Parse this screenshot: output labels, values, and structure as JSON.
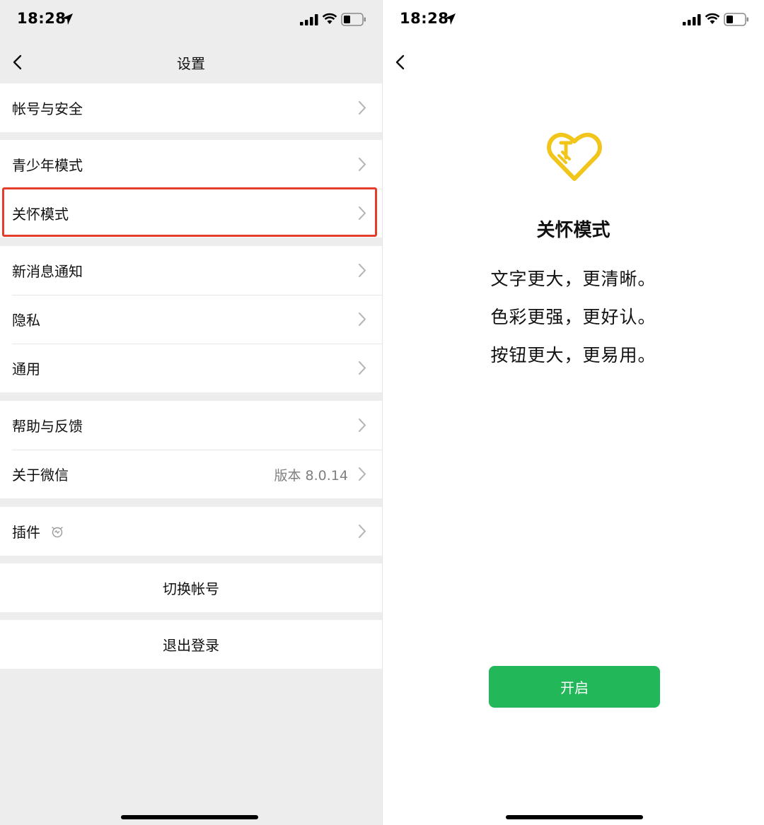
{
  "status_bar": {
    "time": "18:28"
  },
  "left": {
    "nav": {
      "title": "设置"
    },
    "groups": [
      {
        "items": [
          {
            "label": "帐号与安全"
          }
        ]
      },
      {
        "items": [
          {
            "label": "青少年模式"
          },
          {
            "label": "关怀模式"
          }
        ]
      },
      {
        "items": [
          {
            "label": "新消息通知"
          },
          {
            "label": "隐私"
          },
          {
            "label": "通用"
          }
        ]
      },
      {
        "items": [
          {
            "label": "帮助与反馈"
          },
          {
            "label": "关于微信",
            "value": "版本 8.0.14"
          }
        ]
      },
      {
        "items": [
          {
            "label": "插件"
          }
        ]
      }
    ],
    "switch_account": "切换帐号",
    "logout": "退出登录"
  },
  "right": {
    "title": "关怀模式",
    "lines": [
      "文字更大，更清晰。",
      "色彩更强，更好认。",
      "按钮更大，更易用。"
    ],
    "button": "开启"
  },
  "colors": {
    "accent_green": "#22b859",
    "highlight_red": "#e23e2b",
    "logo_yellow": "#f2c51b",
    "background_gray": "#ededed"
  },
  "icons": [
    "location-arrow-icon",
    "signal-icon",
    "wifi-icon",
    "battery-icon",
    "back-chevron-icon",
    "right-chevron-icon",
    "plugin-bulb-icon",
    "care-heart-hand-icon"
  ]
}
